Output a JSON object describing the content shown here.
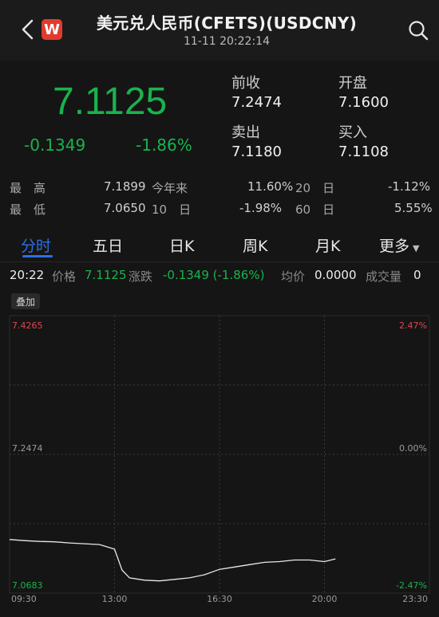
{
  "header": {
    "title": "美元兑人民币(CFETS)(USDCNY)",
    "datetime": "11-11 20:22:14",
    "logo_letter": "W"
  },
  "quote": {
    "price": "7.1125",
    "change": "-0.1349",
    "change_pct": "-1.86%",
    "prev_close_label": "前收",
    "prev_close": "7.2474",
    "open_label": "开盘",
    "open": "7.1600",
    "ask_label": "卖出",
    "ask": "7.1180",
    "bid_label": "买入",
    "bid": "7.1108"
  },
  "stats": {
    "high_label": "最　高",
    "high": "7.1899",
    "ytd_label": "今年来",
    "ytd": "11.60%",
    "d20_label": "20　日",
    "d20": "-1.12%",
    "low_label": "最　低",
    "low": "7.0650",
    "d10_label": "10　日",
    "d10": "-1.98%",
    "d60_label": "60　日",
    "d60": "5.55%"
  },
  "tabs": [
    "分时",
    "五日",
    "日K",
    "周K",
    "月K",
    "更多"
  ],
  "info_row": {
    "time": "20:22",
    "price_label": "价格",
    "price": "7.1125",
    "change_label": "涨跌",
    "change": "-0.1349 (-1.86%)",
    "avg_label": "均价",
    "avg": "0.0000",
    "volume_label": "成交量",
    "volume": "0"
  },
  "overlay_label": "叠加",
  "colors": {
    "up": "#e0454f",
    "down": "#19b34c",
    "accent": "#2e6fe8",
    "line": "#e8e8e8"
  },
  "chart_data": {
    "type": "line",
    "y_labels_left": [
      "7.4265",
      "7.2474",
      "7.0683"
    ],
    "y_labels_right": [
      "2.47%",
      "0.00%",
      "-2.47%"
    ],
    "ylim": [
      7.0683,
      7.4265
    ],
    "x_tick_labels": [
      "09:30",
      "13:00",
      "16:30",
      "20:00",
      "23:30"
    ],
    "x": [
      "09:30",
      "10:00",
      "10:30",
      "11:00",
      "11:30",
      "12:00",
      "12:30",
      "13:00",
      "13:15",
      "13:30",
      "14:00",
      "14:30",
      "15:00",
      "15:30",
      "16:00",
      "16:30",
      "17:00",
      "17:30",
      "18:00",
      "18:30",
      "19:00",
      "19:30",
      "20:00",
      "20:22"
    ],
    "series": [
      {
        "values": [
          7.1375,
          7.136,
          7.135,
          7.1345,
          7.133,
          7.132,
          7.131,
          7.125,
          7.098,
          7.088,
          7.085,
          7.084,
          7.086,
          7.088,
          7.092,
          7.099,
          7.102,
          7.105,
          7.108,
          7.109,
          7.111,
          7.111,
          7.109,
          7.1125
        ]
      }
    ]
  }
}
